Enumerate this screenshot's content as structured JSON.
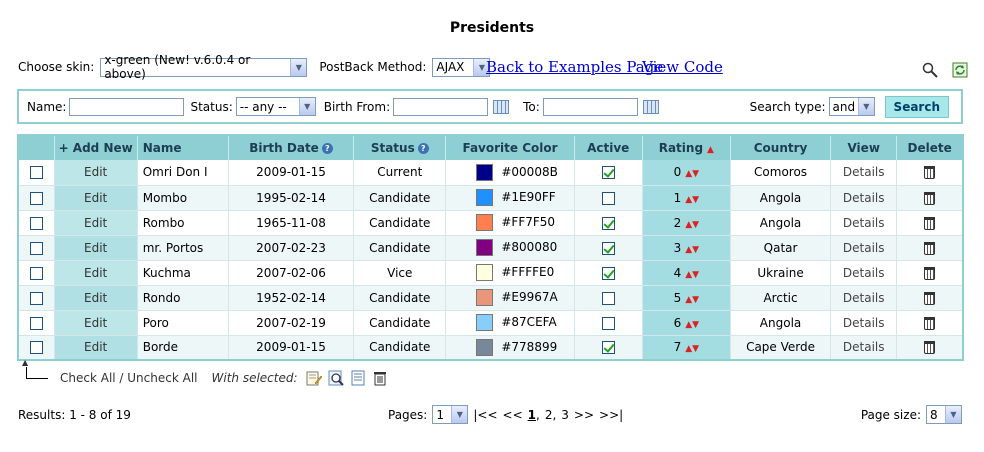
{
  "title": "Presidents",
  "skinbar": {
    "skin_label": "Choose skin:",
    "skin_value": "x-green (New! v.6.0.4 or above)",
    "postback_label": "PostBack Method:",
    "postback_value": "AJAX",
    "back_link": "Back to Examples Page",
    "view_code_link": "View Code"
  },
  "filter": {
    "name_label": "Name:",
    "status_label": "Status:",
    "status_value": "-- any --",
    "birth_from_label": "Birth From:",
    "to_label": "To:",
    "search_type_label": "Search type:",
    "search_type_value": "and",
    "search_button": "Search"
  },
  "grid": {
    "headers": {
      "add_new": "+ Add New",
      "name": "Name",
      "birth_date": "Birth Date",
      "status": "Status",
      "favorite_color": "Favorite Color",
      "active": "Active",
      "rating": "Rating",
      "country": "Country",
      "view": "View",
      "delete": "Delete"
    },
    "edit_label": "Edit",
    "details_label": "Details",
    "rows": [
      {
        "name": "Omri Don I",
        "birth": "2009-01-15",
        "status": "Current",
        "color": "#00008B",
        "active": true,
        "rating": "0",
        "country": "Comoros"
      },
      {
        "name": "Mombo",
        "birth": "1995-02-14",
        "status": "Candidate",
        "color": "#1E90FF",
        "active": false,
        "rating": "1",
        "country": "Angola"
      },
      {
        "name": "Rombo",
        "birth": "1965-11-08",
        "status": "Candidate",
        "color": "#FF7F50",
        "active": true,
        "rating": "2",
        "country": "Angola"
      },
      {
        "name": "mr. Portos",
        "birth": "2007-02-23",
        "status": "Candidate",
        "color": "#800080",
        "active": true,
        "rating": "3",
        "country": "Qatar"
      },
      {
        "name": "Kuchma",
        "birth": "2007-02-06",
        "status": "Vice",
        "color": "#FFFFE0",
        "active": true,
        "rating": "4",
        "country": "Ukraine"
      },
      {
        "name": "Rondo",
        "birth": "1952-02-14",
        "status": "Candidate",
        "color": "#E9967A",
        "active": false,
        "rating": "5",
        "country": "Arctic"
      },
      {
        "name": "Poro",
        "birth": "2007-02-19",
        "status": "Candidate",
        "color": "#87CEFA",
        "active": false,
        "rating": "6",
        "country": "Angola"
      },
      {
        "name": "Borde",
        "birth": "2009-01-15",
        "status": "Candidate",
        "color": "#778899",
        "active": true,
        "rating": "7",
        "country": "Cape Verde"
      }
    ]
  },
  "bulk": {
    "check_all": "Check All / Uncheck All",
    "with_selected": "With selected:"
  },
  "footer": {
    "results": "Results: 1 - 8 of 19",
    "pages_label": "Pages:",
    "pages_value": "1",
    "pager_first": "|<<",
    "pager_prev": "<<",
    "pager_pages": [
      "1",
      "2",
      "3"
    ],
    "pager_next": ">>",
    "pager_last": ">>|",
    "page_size_label": "Page size:",
    "page_size_value": "8"
  },
  "colors": {
    "accent": "#8ECFD4",
    "link": "#0000CC"
  }
}
